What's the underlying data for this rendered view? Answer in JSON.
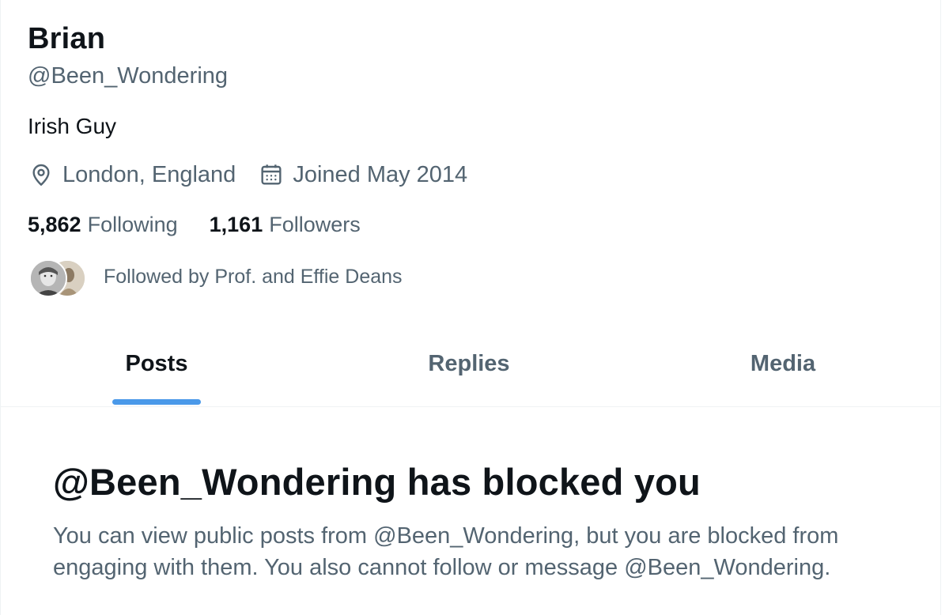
{
  "profile": {
    "name": "Brian",
    "handle": "@Been_Wondering",
    "bio": "Irish Guy",
    "location": "London, England",
    "joined": "Joined May 2014",
    "location_icon": "location-pin-icon",
    "calendar_icon": "calendar-icon"
  },
  "stats": {
    "following_count": "5,862",
    "following_label": "Following",
    "followers_count": "1,161",
    "followers_label": "Followers"
  },
  "followed_by": {
    "text": "Followed by Prof. and Effie Deans"
  },
  "tabs": [
    {
      "label": "Posts",
      "active": true
    },
    {
      "label": "Replies",
      "active": false
    },
    {
      "label": "Media",
      "active": false
    }
  ],
  "blocked": {
    "title": "@Been_Wondering has blocked you",
    "description": "You can view public posts from @Been_Wondering, but you are blocked from engaging with them. You also cannot follow or message @Been_Wondering."
  },
  "colors": {
    "primary_text": "#0f1419",
    "secondary_text": "#536471",
    "accent": "#4a99e9",
    "border": "#eff3f4"
  }
}
